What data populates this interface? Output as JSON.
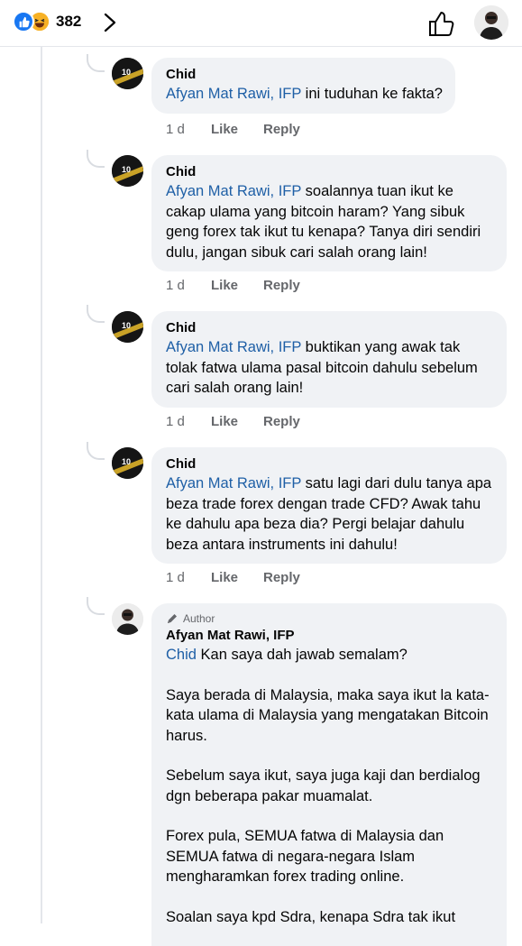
{
  "header": {
    "reaction_count": "382"
  },
  "comments": [
    {
      "author": "Chid",
      "mention": "Afyan Mat Rawi, IFP",
      "text": " ini tuduhan ke fakta?",
      "time": "1 d",
      "like_label": "Like",
      "reply_label": "Reply"
    },
    {
      "author": "Chid",
      "mention": "Afyan Mat Rawi, IFP",
      "text": " soalannya tuan ikut ke cakap ulama yang bitcoin haram? Yang sibuk geng forex tak ikut tu kenapa? Tanya diri sendiri dulu, jangan sibuk cari salah orang lain!",
      "time": "1 d",
      "like_label": "Like",
      "reply_label": "Reply"
    },
    {
      "author": "Chid",
      "mention": "Afyan Mat Rawi, IFP",
      "text": " buktikan yang awak tak tolak fatwa ulama pasal bitcoin dahulu sebelum cari salah orang lain!",
      "time": "1 d",
      "like_label": "Like",
      "reply_label": "Reply"
    },
    {
      "author": "Chid",
      "mention": "Afyan Mat Rawi, IFP",
      "text": " satu lagi dari dulu tanya apa beza trade forex dengan trade CFD? Awak tahu ke dahulu apa beza dia? Pergi belajar dahulu beza antara instruments ini dahulu!",
      "time": "1 d",
      "like_label": "Like",
      "reply_label": "Reply"
    }
  ],
  "author_reply": {
    "badge": "Author",
    "author": "Afyan Mat Rawi, IFP",
    "mention": "Chid",
    "first_line": " Kan saya dah jawab semalam?",
    "paragraphs": [
      "Saya berada di Malaysia, maka saya ikut la kata-kata ulama di Malaysia yang mengatakan Bitcoin harus.",
      "Sebelum saya ikut, saya juga kaji dan berdialog dgn beberapa pakar muamalat.",
      "Forex pula, SEMUA fatwa di Malaysia dan SEMUA fatwa di negara-negara Islam mengharamkan forex trading online.",
      "Soalan saya kpd Sdra, kenapa Sdra tak ikut"
    ]
  },
  "colors": {
    "mention": "#1e5fa6",
    "bubble": "#f0f2f5",
    "like_blue": "#1877f2"
  },
  "icons": [
    "like-reaction-icon",
    "haha-reaction-icon",
    "chevron-right-icon",
    "thumbs-up-icon",
    "pencil-icon"
  ]
}
